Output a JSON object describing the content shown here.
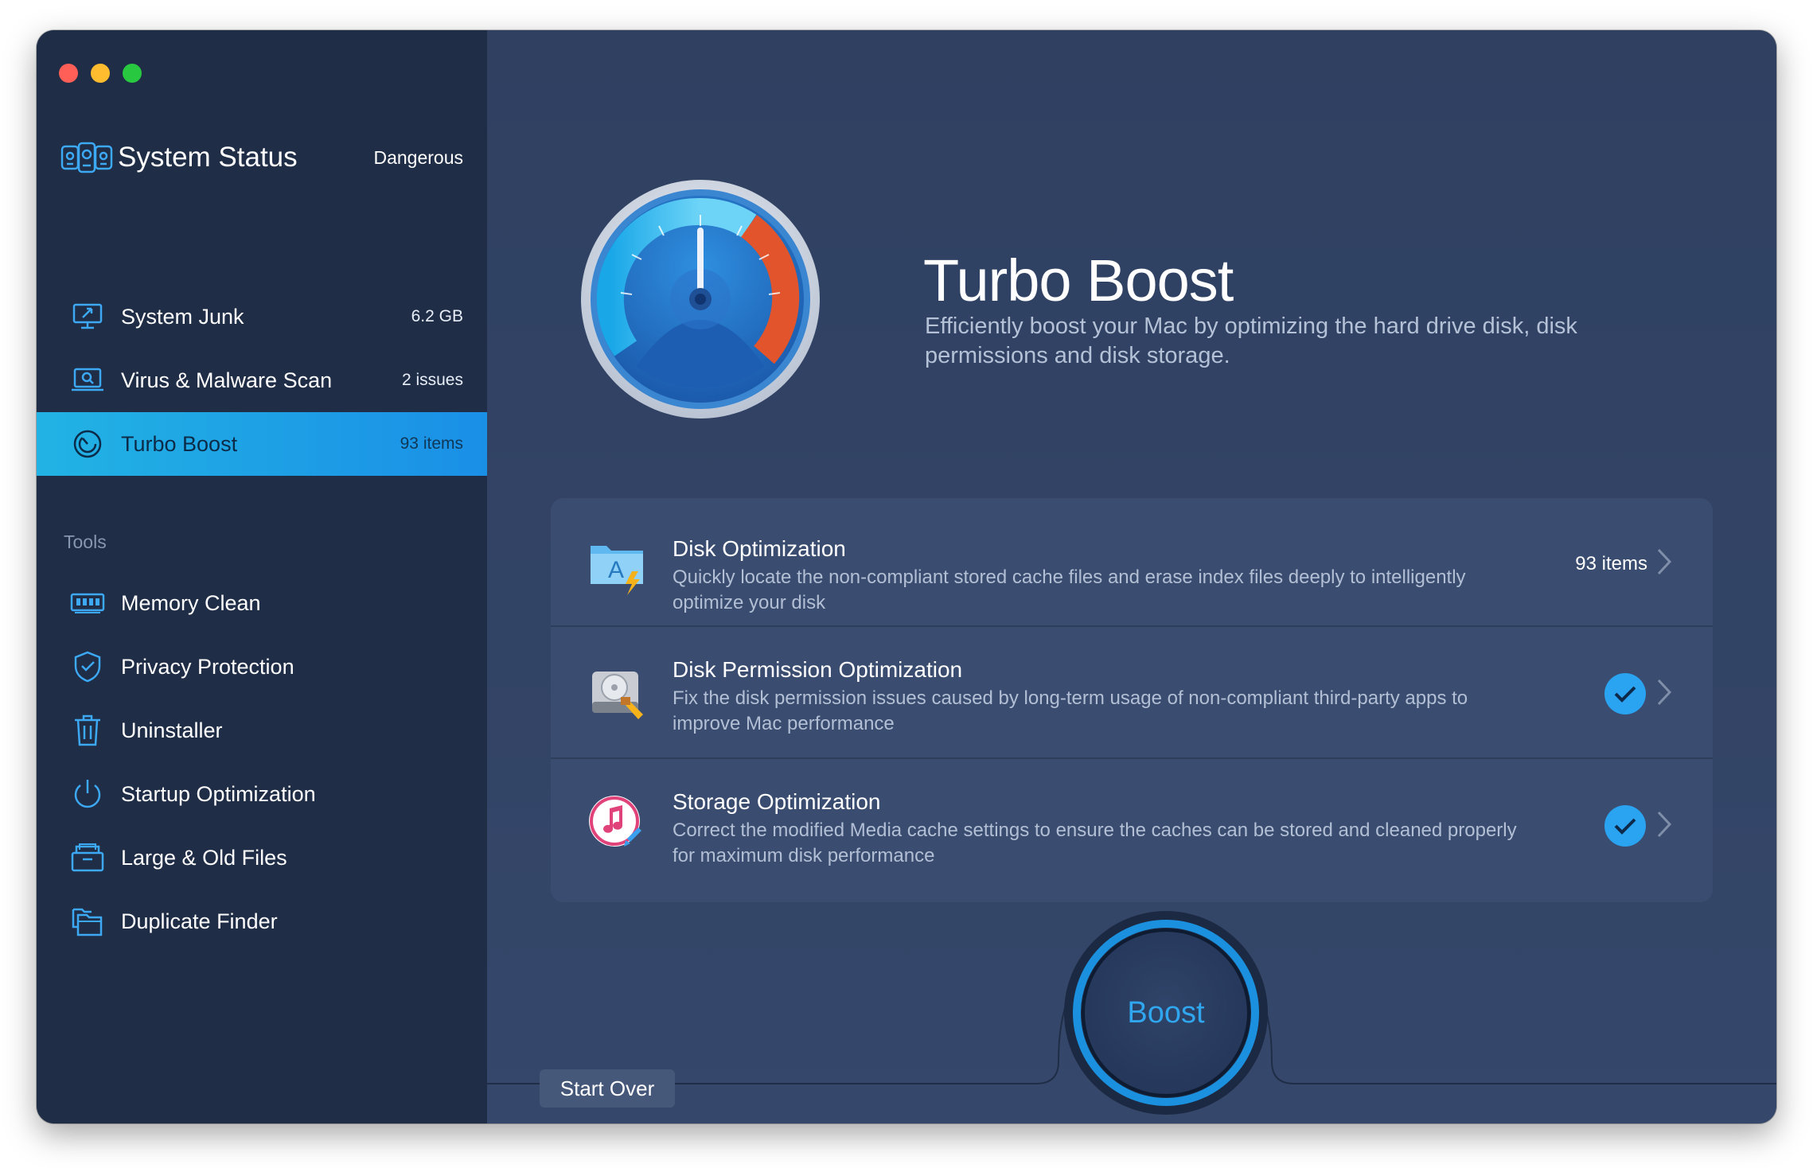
{
  "sidebar": {
    "status": {
      "title": "System Status",
      "state": "Dangerous"
    },
    "items": [
      {
        "label": "System Junk",
        "meta": "6.2 GB",
        "icon": "monitor-icon"
      },
      {
        "label": "Virus & Malware Scan",
        "meta": "2 issues",
        "icon": "scan-icon"
      },
      {
        "label": "Turbo Boost",
        "meta": "93 items",
        "icon": "speedometer-icon",
        "active": true
      }
    ],
    "tools_title": "Tools",
    "tools": [
      {
        "label": "Memory Clean",
        "icon": "memory-icon"
      },
      {
        "label": "Privacy Protection",
        "icon": "shield-icon"
      },
      {
        "label": "Uninstaller",
        "icon": "trash-icon"
      },
      {
        "label": "Startup Optimization",
        "icon": "power-icon"
      },
      {
        "label": "Large & Old Files",
        "icon": "files-icon"
      },
      {
        "label": "Duplicate Finder",
        "icon": "folder-icon"
      }
    ]
  },
  "hero": {
    "title": "Turbo Boost",
    "description": "Efficiently boost your Mac by optimizing the hard drive disk, disk permissions and disk storage."
  },
  "options": [
    {
      "title": "Disk Optimization",
      "description": "Quickly locate the non-compliant stored cache files and erase index files deeply to intelligently optimize your disk",
      "count": "93 items",
      "checked": false
    },
    {
      "title": "Disk Permission Optimization",
      "description": "Fix the disk permission issues caused by long-term usage of non-compliant third-party apps to improve Mac performance",
      "checked": true
    },
    {
      "title": "Storage Optimization",
      "description": "Correct the modified Media cache settings to ensure the caches can be stored and cleaned properly for maximum disk performance",
      "checked": true
    }
  ],
  "footer": {
    "start_over": "Start Over",
    "boost": "Boost"
  },
  "colors": {
    "accent": "#2aa3f0",
    "sidebar_bg": "#1f2d47",
    "main_bg": "#2f4061"
  }
}
